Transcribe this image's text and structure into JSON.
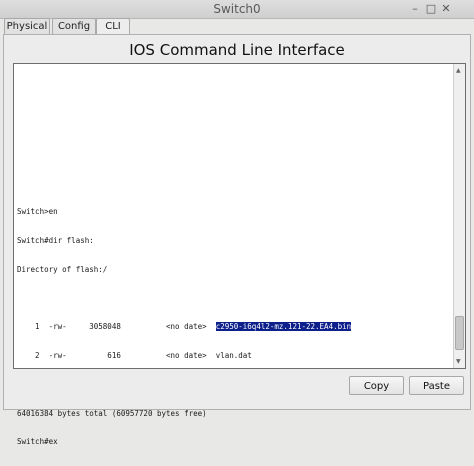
{
  "window": {
    "title": "Switch0",
    "min_label": "–",
    "max_label": "□",
    "close_label": "✕"
  },
  "tabs": [
    {
      "label": "Physical"
    },
    {
      "label": "Config"
    },
    {
      "label": "CLI"
    }
  ],
  "header": {
    "title": "IOS Command Line Interface"
  },
  "terminal": {
    "prompt_en": "Switch>en",
    "cmd_dir": "Switch#dir flash:",
    "dir_of": "Directory of flash:/",
    "files": [
      {
        "prefix": "    1  -rw-     3058048          <no date>  ",
        "name": "c2950-i6q4l2-mz.121-22.EA4.bin"
      },
      {
        "prefix": "    2  -rw-         616          <no date>  ",
        "name": "vlan.dat"
      }
    ],
    "summary": "64016384 bytes total (60957720 bytes free)",
    "last_line": "Switch#ex"
  },
  "buttons": {
    "copy": "Copy",
    "paste": "Paste"
  }
}
